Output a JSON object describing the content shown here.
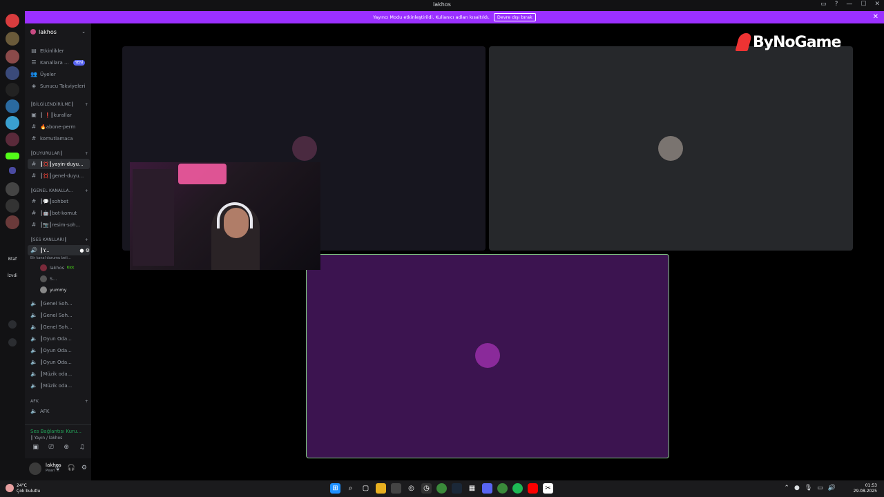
{
  "window": {
    "title": "lakhos"
  },
  "banner": {
    "text": "Yayıncı Modu etkinleştirildi. Kullanıcı adları kısaltıldı.",
    "button_label": "Devre dışı bırak"
  },
  "guilds": [
    {
      "label": "Btaf"
    },
    {
      "label": "İzvdi"
    }
  ],
  "server": {
    "name": "lakhos"
  },
  "menu": [
    {
      "label": "Etkinlikler"
    },
    {
      "label": "Kanallara ...",
      "badge": "YENİ"
    },
    {
      "label": "Üyeler"
    },
    {
      "label": "Sunucu Takviyeleri"
    }
  ],
  "categories": {
    "info": "┃BİLGİLENDİRİLME┃",
    "announcements": "┃DUYURULAR┃",
    "general": "┃GENEL KANALLA...",
    "voice": "┃SES KANLLARI┃",
    "afk": "AFK"
  },
  "text_channels": {
    "info": [
      "┃ ❗┃kurallar",
      "🔥abone-perm",
      "komutlamaca"
    ],
    "announcements": [
      "┃💢┃yayin-duyu...",
      "┃💢┃genel-duyu..."
    ],
    "general": [
      "┃💬┃sohbet",
      "┃🤖┃bot-komut",
      "┃📷┃resim-soh..."
    ]
  },
  "voice": {
    "active_channel": "┃Y...",
    "active_status": "Bir kanal durumu beli...",
    "members": [
      "lakhos",
      "S...",
      "yummy"
    ],
    "member_tag": "Kick",
    "channels": [
      "┃Genel Soh...",
      "┃Genel Soh...",
      "┃Genel Soh...",
      "┃Oyun Oda...",
      "┃Oyun Oda...",
      "┃Oyun Oda...",
      "┃Müzik oda...",
      "┃Müzik oda..."
    ],
    "afk_channel": "AFK"
  },
  "voice_panel": {
    "status": "Ses Bağlantısı Kuru...",
    "location": "┃ Yayın / lakhos"
  },
  "user": {
    "name": "lakhos",
    "status": "Pearl ..."
  },
  "overlay": {
    "logo_text": "ByNoGame"
  },
  "taskbar": {
    "weather_temp": "24°C",
    "weather_desc": "Çok bulutlu",
    "time": "01:53",
    "date": "29.08.2025"
  }
}
